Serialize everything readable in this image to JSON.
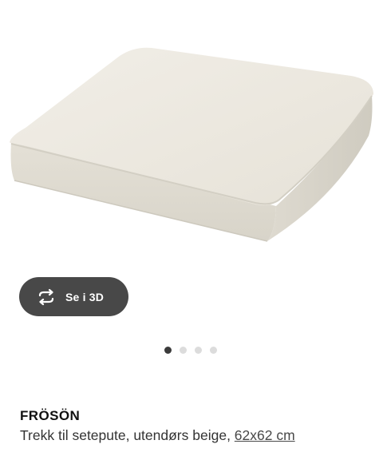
{
  "view_3d": {
    "label": "Se i 3D",
    "icon": "rotate-3d-icon"
  },
  "carousel": {
    "total": 4,
    "active_index": 0
  },
  "product": {
    "name": "FRÖSÖN",
    "description": "Trekk til setepute, utendørs beige, ",
    "size": "62x62 cm"
  },
  "colors": {
    "button_bg": "#484848",
    "dot_active": "#3b3b3b",
    "dot_inactive": "#dcdcdc",
    "cushion": "#ece8df"
  }
}
